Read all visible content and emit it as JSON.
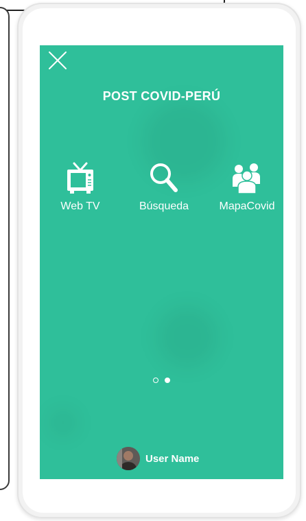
{
  "app": {
    "title": "POST COVID-PERÚ",
    "accent_color": "#2fbf9a"
  },
  "menu": {
    "items": [
      {
        "label": "Web TV",
        "icon": "tv-icon"
      },
      {
        "label": "Búsqueda",
        "icon": "search-icon"
      },
      {
        "label": "MapaCovid",
        "icon": "people-icon"
      }
    ]
  },
  "pagination": {
    "current_page": 2,
    "total_pages": 2
  },
  "user": {
    "name": "User Name"
  }
}
